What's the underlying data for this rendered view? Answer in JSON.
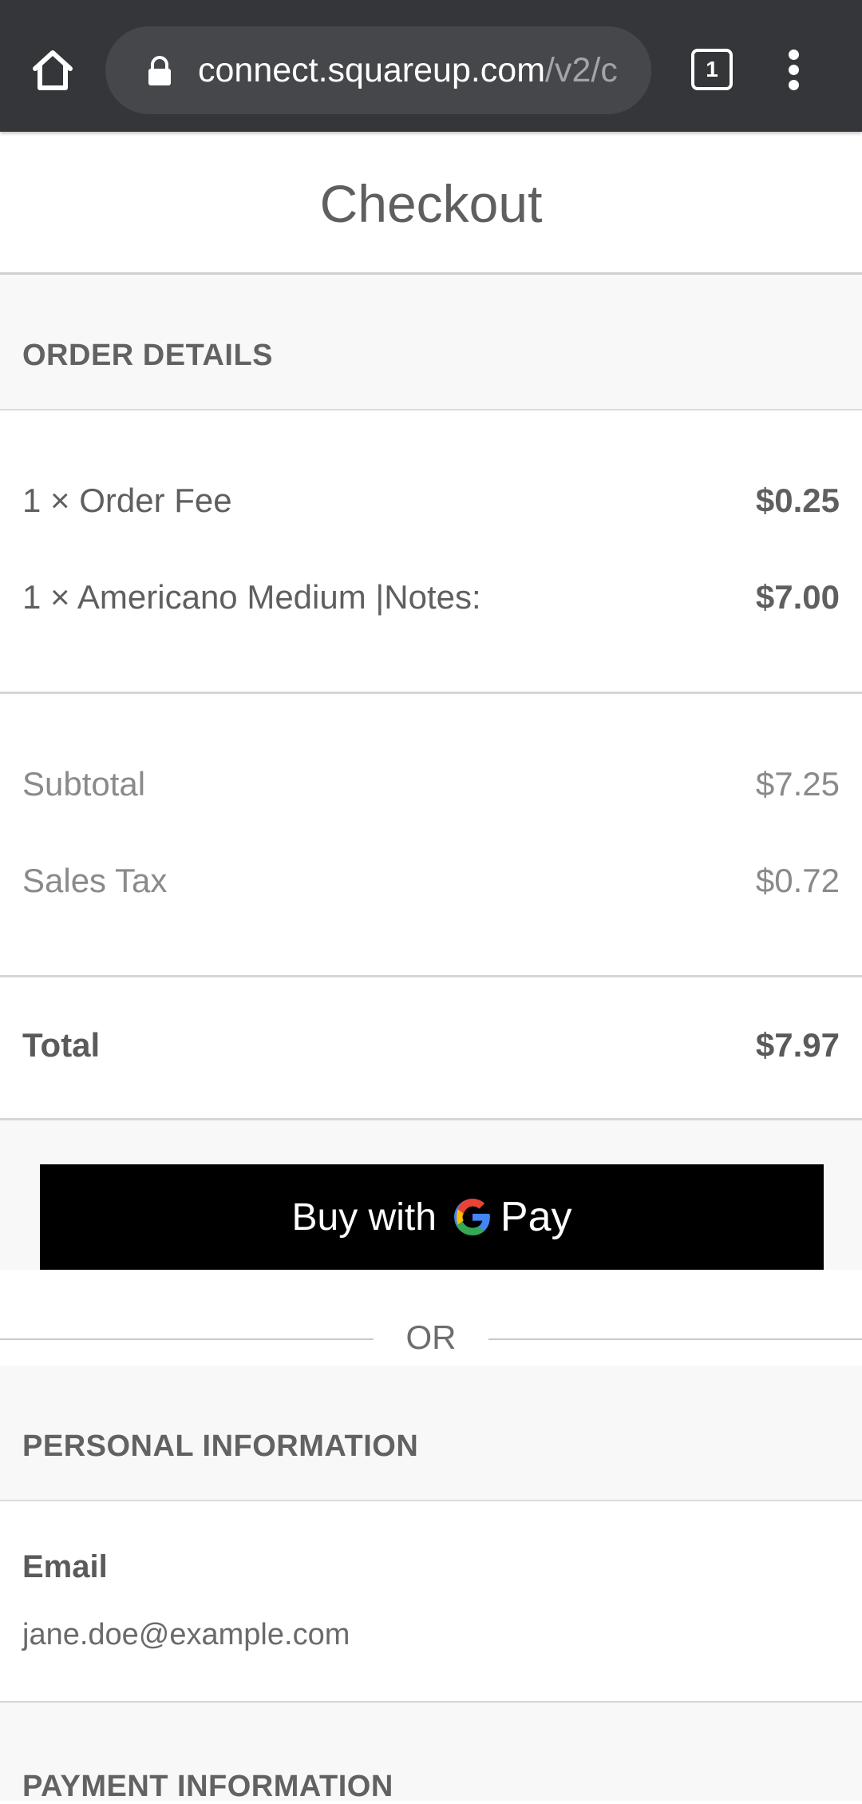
{
  "browser": {
    "url_host": "connect.squareup.com",
    "url_path": "/v2/c",
    "tab_count": "1",
    "icons": {
      "home": "home-icon",
      "lock": "lock-icon",
      "tabs": "tab-switcher-icon",
      "menu": "overflow-menu-icon"
    }
  },
  "page": {
    "title": "Checkout"
  },
  "order": {
    "section_title": "ORDER DETAILS",
    "items": [
      {
        "label": "1 × Order Fee",
        "value": "$0.25"
      },
      {
        "label": "1 × Americano Medium |Notes:",
        "value": "$7.00"
      }
    ],
    "subtotal_label": "Subtotal",
    "subtotal_value": "$7.25",
    "tax_label": "Sales Tax",
    "tax_value": "$0.72",
    "total_label": "Total",
    "total_value": "$7.97"
  },
  "gpay": {
    "buy_label": "Buy with",
    "pay_label": "Pay",
    "logo_icon": "google-g-icon"
  },
  "separator": {
    "or_label": "OR"
  },
  "personal": {
    "section_title": "PERSONAL INFORMATION",
    "email_label": "Email",
    "email_value": "jane.doe@example.com"
  },
  "payment": {
    "section_title": "PAYMENT INFORMATION"
  },
  "colors": {
    "browser_bar": "#35363a",
    "url_pill": "#46474b",
    "section_bg": "#f8f8f8",
    "gpay_button": "#000000",
    "text": "#5f5f5f"
  }
}
